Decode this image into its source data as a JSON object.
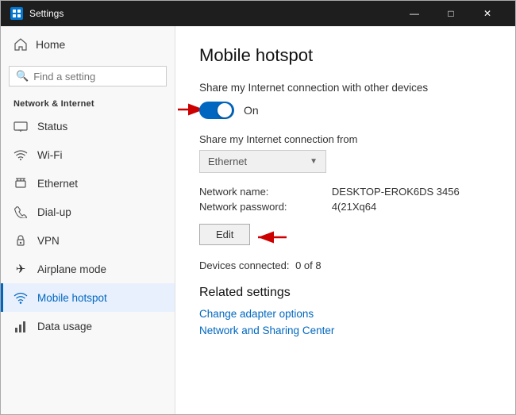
{
  "window": {
    "title": "Settings",
    "controls": {
      "minimize": "—",
      "maximize": "□",
      "close": "✕"
    }
  },
  "sidebar": {
    "home_label": "Home",
    "search_placeholder": "Find a setting",
    "section_label": "Network & Internet",
    "items": [
      {
        "id": "status",
        "label": "Status",
        "icon": "🖥"
      },
      {
        "id": "wifi",
        "label": "Wi-Fi",
        "icon": "📶"
      },
      {
        "id": "ethernet",
        "label": "Ethernet",
        "icon": "🔌"
      },
      {
        "id": "dialup",
        "label": "Dial-up",
        "icon": "📞"
      },
      {
        "id": "vpn",
        "label": "VPN",
        "icon": "🔒"
      },
      {
        "id": "airplane",
        "label": "Airplane mode",
        "icon": "✈"
      },
      {
        "id": "hotspot",
        "label": "Mobile hotspot",
        "icon": "📡",
        "active": true
      },
      {
        "id": "data",
        "label": "Data usage",
        "icon": "📊"
      }
    ]
  },
  "main": {
    "title": "Mobile hotspot",
    "share_label": "Share my Internet connection with other devices",
    "toggle_state": "On",
    "share_from_label": "Share my Internet connection from",
    "dropdown_value": "Ethernet",
    "network_name_key": "Network name:",
    "network_name_val": "DESKTOP-EROK6DS 3456",
    "network_password_key": "Network password:",
    "network_password_val": "4(21Xq64",
    "edit_btn_label": "Edit",
    "devices_key": "Devices connected:",
    "devices_val": "0 of 8",
    "related_title": "Related settings",
    "links": [
      {
        "id": "change-adapter",
        "label": "Change adapter options"
      },
      {
        "id": "network-sharing",
        "label": "Network and Sharing Center"
      }
    ]
  }
}
